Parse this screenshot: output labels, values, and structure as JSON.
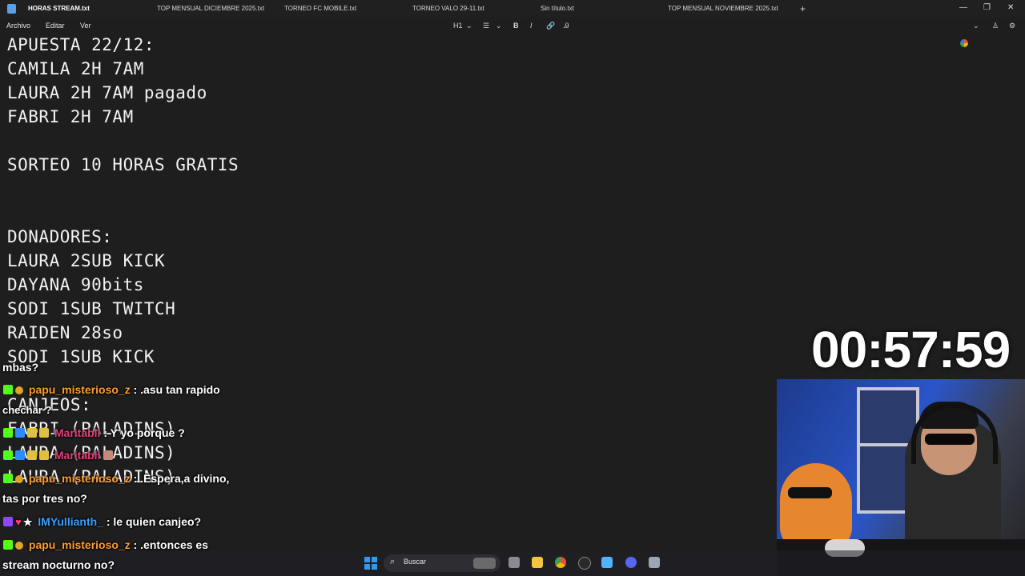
{
  "tabs": [
    {
      "label": "HORAS STREAM.txt",
      "active": true
    },
    {
      "label": "TOP MENSUAL DICIEMBRE 2025.txt"
    },
    {
      "label": "TORNEO FC MOBILE.txt"
    },
    {
      "label": "TORNEO VALO 29-11.txt"
    },
    {
      "label": "Sin título.txt"
    },
    {
      "label": "TOP MENSUAL NOVIEMBRE 2025.txt"
    }
  ],
  "menu": {
    "archivo": "Archivo",
    "editar": "Editar",
    "ver": "Ver"
  },
  "toolbar": {
    "heading": "H1",
    "bold": "B",
    "italic": "I"
  },
  "editor_lines": [
    "APUESTA 22/12:",
    "CAMILA 2H 7AM",
    "LAURA 2H 7AM pagado",
    "FABRI 2H 7AM",
    "",
    "SORTEO 10 HORAS GRATIS",
    "",
    "",
    "DONADORES:",
    "LAURA 2SUB KICK",
    "DAYANA 90bits",
    "SODI 1SUB TWITCH",
    "RAIDEN 28so",
    "SODI 1SUB KICK",
    "",
    "CANJEOS:",
    "FABRI (PALADINS)",
    "LAURA (PALADINS)",
    "LAURA (PALADINS)"
  ],
  "timer": "00:57:59",
  "chat": {
    "frag1": "mbas?",
    "m1_user": "papu_misterioso_z",
    "m1_text": ": .asu tan rapido",
    "frag2": "chechar ?",
    "m2_user": "Maritabll",
    "m2_text": ": Y yo porque ?",
    "m3_user": "Maritabll",
    "m4_user": "papu_misterioso_z",
    "m4_text": ": .Espera,a divino,",
    "m4_cont": "tas por tres no?",
    "m5_user": "IMYullianth_",
    "m5_text": ": le quien canjeo?",
    "m6_user": "papu_misterioso_z",
    "m6_text": ": .entonces es",
    "m6_cont": "stream nocturno no?"
  },
  "taskbar": {
    "search_label": "Buscar"
  },
  "icons": {
    "app": "notepad-icon",
    "new_tab": "plus-icon",
    "search": "search-icon",
    "windows": "windows-start-icon",
    "bold": "bold-icon",
    "italic": "italic-icon",
    "list": "list-icon",
    "link": "link-icon",
    "copilot": "copilot-icon",
    "settings": "gear-icon"
  }
}
